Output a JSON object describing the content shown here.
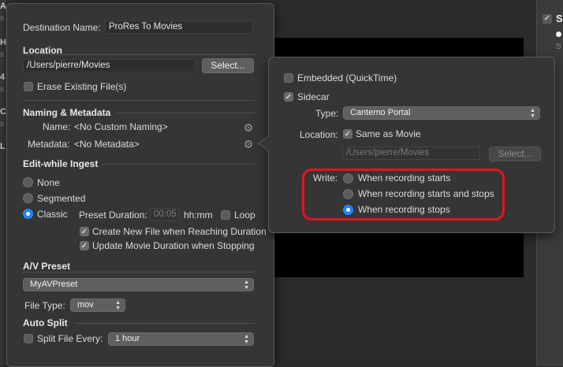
{
  "background": {
    "left_fragments": [
      "A",
      "s",
      "H",
      "s",
      "4",
      "s",
      "C",
      "s",
      "L"
    ],
    "right_pane": {
      "title": "S",
      "sub": "S"
    }
  },
  "destination": {
    "name_label": "Destination Name:",
    "name_value": "ProRes To Movies",
    "location_header": "Location",
    "location_path": "/Users/pierre/Movies",
    "select_button": "Select...",
    "erase_label": "Erase Existing File(s)",
    "erase_checked": false
  },
  "naming": {
    "header": "Naming & Metadata",
    "name_label": "Name:",
    "name_value": "<No Custom Naming>",
    "metadata_label": "Metadata:",
    "metadata_value": "<No Metadata>"
  },
  "edit_while_ingest": {
    "header": "Edit-while Ingest",
    "options": [
      "None",
      "Segmented",
      "Classic"
    ],
    "selected": "Classic",
    "preset_duration_label": "Preset Duration:",
    "preset_duration_value": "00:05",
    "preset_duration_unit": "hh:mm",
    "loop_label": "Loop",
    "loop_checked": false,
    "create_new_label": "Create New File when Reaching Duration",
    "create_new_checked": true,
    "update_duration_label": "Update Movie Duration when Stopping",
    "update_duration_checked": true
  },
  "av_preset": {
    "header": "A/V Preset",
    "value": "MyAVPreset",
    "file_type_label": "File Type:",
    "file_type_value": "mov"
  },
  "auto_split": {
    "header": "Auto Split",
    "split_label": "Split File Every:",
    "split_checked": false,
    "split_value": "1 hour"
  },
  "metadata_popover": {
    "embedded_label": "Embedded (QuickTime)",
    "embedded_checked": false,
    "sidecar_label": "Sidecar",
    "sidecar_checked": true,
    "type_label": "Type:",
    "type_value": "Cantemo Portal",
    "location_label": "Location:",
    "same_as_movie_label": "Same as Movie",
    "same_as_movie_checked": true,
    "location_path": "/Users/pierre/Movies",
    "select_button": "Select...",
    "write_label": "Write:",
    "write_options": [
      "When recording starts",
      "When recording starts and stops",
      "When recording stops"
    ],
    "write_selected": "When recording stops",
    "highlight_color": "#e4141e"
  },
  "colors": {
    "accent": "#1a82fb",
    "panel": "#353535"
  }
}
